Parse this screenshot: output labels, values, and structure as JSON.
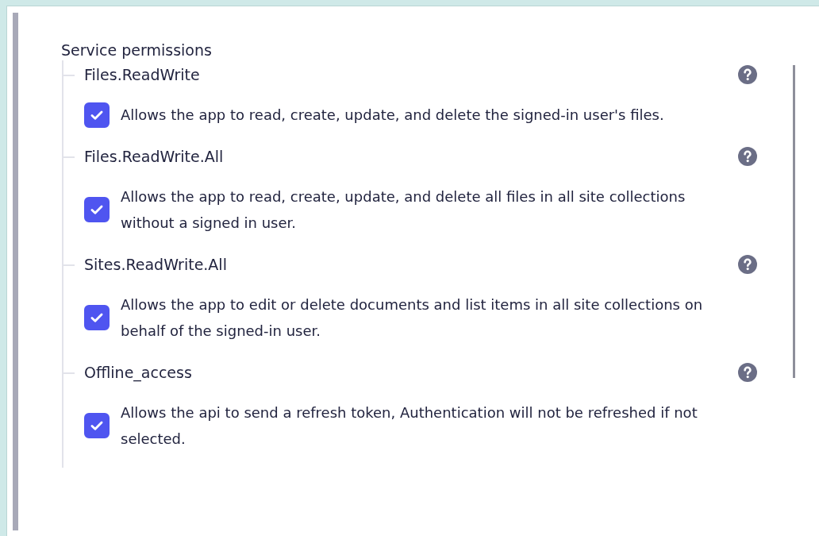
{
  "section": {
    "title": "Service permissions"
  },
  "permissions": [
    {
      "name": "Files.ReadWrite",
      "description": "Allows the app to read, create, update, and delete the signed-in user's files.",
      "checked": true
    },
    {
      "name": "Files.ReadWrite.All",
      "description": "Allows the app to read, create, update, and delete all files in all site collections without a signed in user.",
      "checked": true
    },
    {
      "name": "Sites.ReadWrite.All",
      "description": "Allows the app to edit or delete documents and list items in all site collections on behalf of the signed-in user.",
      "checked": true
    },
    {
      "name": "Offline_access",
      "description": "Allows the api to send a refresh token, Authentication will not be refreshed if not selected.",
      "checked": true
    }
  ]
}
